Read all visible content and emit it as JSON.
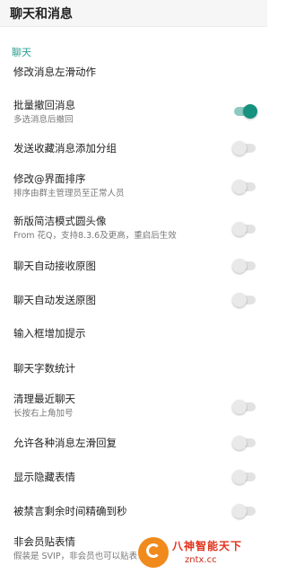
{
  "header": {
    "title": "聊天和消息"
  },
  "section": {
    "title": "聊天"
  },
  "settings": [
    {
      "label": "修改消息左滑动作",
      "sub": null,
      "toggle": null
    },
    {
      "label": "批量撤回消息",
      "sub": "多选消息后撤回",
      "toggle": true
    },
    {
      "label": "发送收藏消息添加分组",
      "sub": null,
      "toggle": false
    },
    {
      "label": "修改@界面排序",
      "sub": "排序由群主管理员至正常人员",
      "toggle": false
    },
    {
      "label": "新版简洁模式圆头像",
      "sub": "From 花Q，支持8.3.6及更高，重启后生效",
      "toggle": false
    },
    {
      "label": "聊天自动接收原图",
      "sub": null,
      "toggle": false
    },
    {
      "label": "聊天自动发送原图",
      "sub": null,
      "toggle": false
    },
    {
      "label": "输入框增加提示",
      "sub": null,
      "toggle": null
    },
    {
      "label": "聊天字数统计",
      "sub": null,
      "toggle": null
    },
    {
      "label": "清理最近聊天",
      "sub": "长按右上角加号",
      "toggle": false
    },
    {
      "label": "允许各种消息左滑回复",
      "sub": null,
      "toggle": false
    },
    {
      "label": "显示隐藏表情",
      "sub": null,
      "toggle": false
    },
    {
      "label": "被禁言剩余时间精确到秒",
      "sub": null,
      "toggle": false
    },
    {
      "label": "非会员贴表情",
      "sub": "假装是 SVIP，非会员也可以贴表情",
      "toggle": null
    }
  ],
  "watermark": {
    "title": "八神智能天下",
    "url": "zntx.cc"
  },
  "colors": {
    "accent": "#16917f",
    "section_header": "#2b9e90"
  }
}
